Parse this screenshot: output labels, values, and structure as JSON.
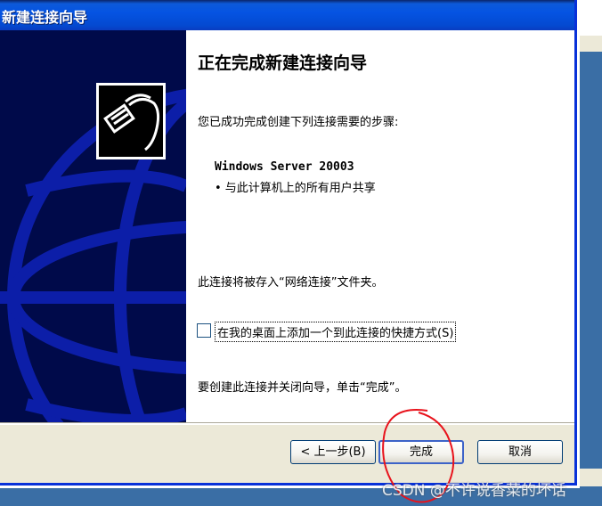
{
  "window": {
    "title": "新建连接向导"
  },
  "main": {
    "heading": "正在完成新建连接向导",
    "intro": "您已成功完成创建下列连接需要的步骤:",
    "connection_name": "Windows Server 20003",
    "bullet_item": "• 与此计算机上的所有用户共享",
    "save_note": "此连接将被存入“网络连接”文件夹。",
    "shortcut_checkbox": {
      "label": "在我的桌面上添加一个到此连接的快捷方式(S)",
      "checked": false
    },
    "finish_note": "要创建此连接并关闭向导，单击“完成”。"
  },
  "buttons": {
    "back": "< 上一步(B)",
    "finish": "完成",
    "cancel": "取消"
  },
  "watermark": "CSDN @不许说香菜的坏话",
  "colors": {
    "titlebar": "#0554e3",
    "side_panel": "#000a4a",
    "globe_lines": "#0c1ea8",
    "annotation": "#e8131c"
  },
  "icons": {
    "wizard_logo": "network-cable-icon"
  }
}
